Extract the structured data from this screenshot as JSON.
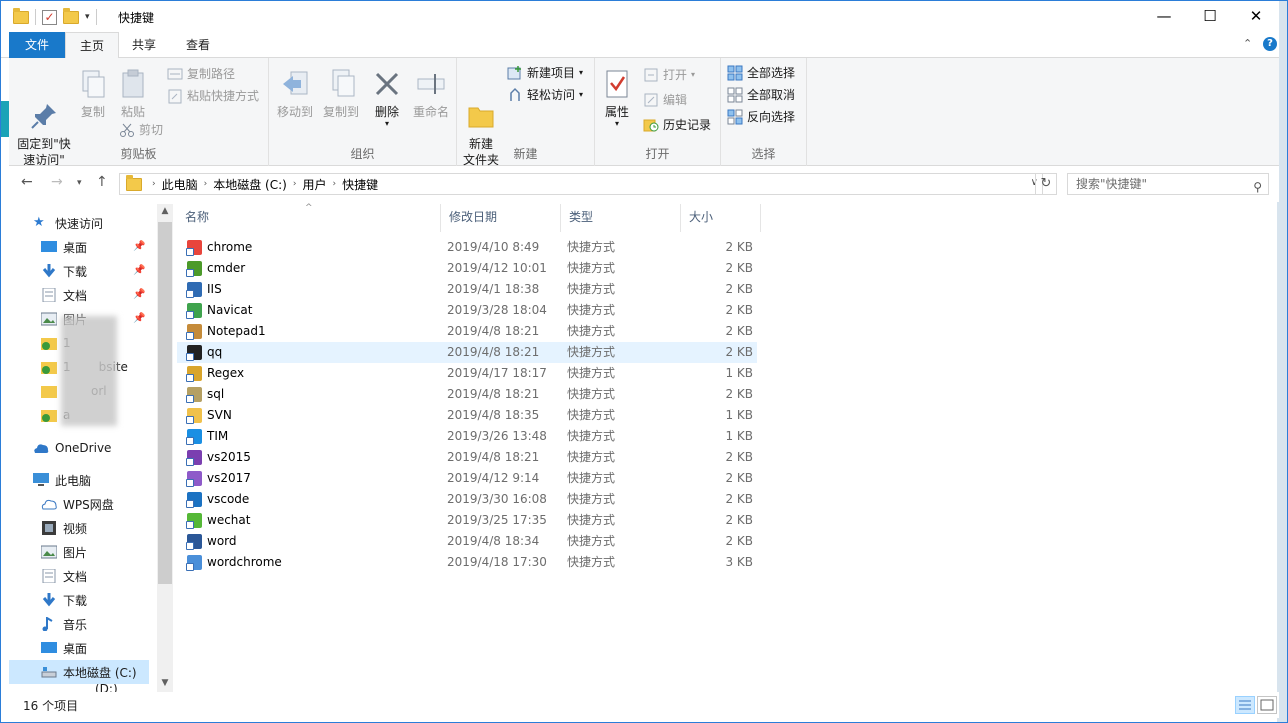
{
  "window": {
    "title": "快捷键",
    "minimize": "—",
    "maximize": "☐",
    "close": "✕"
  },
  "tabs": [
    "文件",
    "主页",
    "共享",
    "查看"
  ],
  "ribbon": {
    "clipboard": {
      "label": "剪贴板",
      "pin": "固定到\"快\n速访问\"",
      "copy": "复制",
      "paste": "粘贴",
      "copy_path": "复制路径",
      "paste_shortcut": "粘贴快捷方式",
      "cut": "剪切"
    },
    "organize": {
      "label": "组织",
      "move_to": "移动到",
      "copy_to": "复制到",
      "delete": "删除",
      "rename": "重命名"
    },
    "new": {
      "label": "新建",
      "new_folder": "新建\n文件夹",
      "new_item": "新建项目",
      "easy_access": "轻松访问"
    },
    "open": {
      "label": "打开",
      "properties": "属性",
      "open": "打开",
      "edit": "编辑",
      "history": "历史记录"
    },
    "select": {
      "label": "选择",
      "select_all": "全部选择",
      "select_none": "全部取消",
      "invert": "反向选择"
    }
  },
  "address": {
    "crumbs": [
      "此电脑",
      "本地磁盘 (C:)",
      "用户",
      "快捷键"
    ],
    "search_placeholder": "搜索\"快捷键\""
  },
  "nav": {
    "quick_access": "快速访问",
    "quick_items": [
      "桌面",
      "下载",
      "文档",
      "图片",
      "1",
      "1",
      "",
      "a"
    ],
    "quick_suffix": [
      "",
      "",
      "",
      "",
      "",
      "bsite",
      "orl",
      ""
    ],
    "onedrive": "OneDrive",
    "this_pc": "此电脑",
    "pc_items": [
      "WPS网盘",
      "视频",
      "图片",
      "文档",
      "下载",
      "音乐",
      "桌面",
      "本地磁盘 (C:)"
    ],
    "partial": "(D:)"
  },
  "columns": [
    "名称",
    "修改日期",
    "类型",
    "大小"
  ],
  "files": [
    {
      "name": "chrome",
      "date": "2019/4/10 8:49",
      "type": "快捷方式",
      "size": "2 KB",
      "color": "#e8453c"
    },
    {
      "name": "cmder",
      "date": "2019/4/12 10:01",
      "type": "快捷方式",
      "size": "2 KB",
      "color": "#4c9a2a"
    },
    {
      "name": "IIS",
      "date": "2019/4/1 18:38",
      "type": "快捷方式",
      "size": "2 KB",
      "color": "#2f6bb3"
    },
    {
      "name": "Navicat",
      "date": "2019/3/28 18:04",
      "type": "快捷方式",
      "size": "2 KB",
      "color": "#3fa34d"
    },
    {
      "name": "Notepad1",
      "date": "2019/4/8 18:21",
      "type": "快捷方式",
      "size": "2 KB",
      "color": "#c58b3a"
    },
    {
      "name": "qq",
      "date": "2019/4/8 18:21",
      "type": "快捷方式",
      "size": "2 KB",
      "color": "#222222"
    },
    {
      "name": "Regex",
      "date": "2019/4/17 18:17",
      "type": "快捷方式",
      "size": "1 KB",
      "color": "#d9a52c"
    },
    {
      "name": "sql",
      "date": "2019/4/8 18:21",
      "type": "快捷方式",
      "size": "2 KB",
      "color": "#b5a063"
    },
    {
      "name": "SVN",
      "date": "2019/4/8 18:35",
      "type": "快捷方式",
      "size": "1 KB",
      "color": "#f0c14b"
    },
    {
      "name": "TIM",
      "date": "2019/3/26 13:48",
      "type": "快捷方式",
      "size": "1 KB",
      "color": "#1a8fe3"
    },
    {
      "name": "vs2015",
      "date": "2019/4/8 18:21",
      "type": "快捷方式",
      "size": "2 KB",
      "color": "#7b3fb0"
    },
    {
      "name": "vs2017",
      "date": "2019/4/12 9:14",
      "type": "快捷方式",
      "size": "2 KB",
      "color": "#8e5ac9"
    },
    {
      "name": "vscode",
      "date": "2019/3/30 16:08",
      "type": "快捷方式",
      "size": "2 KB",
      "color": "#1b72c2"
    },
    {
      "name": "wechat",
      "date": "2019/3/25 17:35",
      "type": "快捷方式",
      "size": "2 KB",
      "color": "#55b837"
    },
    {
      "name": "word",
      "date": "2019/4/8 18:34",
      "type": "快捷方式",
      "size": "2 KB",
      "color": "#2b5797"
    },
    {
      "name": "wordchrome",
      "date": "2019/4/18 17:30",
      "type": "快捷方式",
      "size": "3 KB",
      "color": "#4a8fd9"
    }
  ],
  "status": {
    "count": "16 个项目"
  },
  "colors": {
    "accent": "#1979ca",
    "selection": "#cce8ff",
    "hover": "#e5f3ff"
  }
}
